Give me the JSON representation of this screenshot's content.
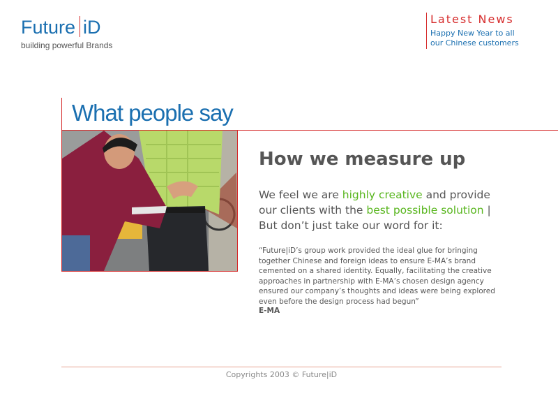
{
  "brand": {
    "name_left": "Future",
    "name_right": "iD",
    "tagline": "building powerful Brands"
  },
  "news": {
    "title": "Latest News",
    "item_line1": "Happy New Year to all",
    "item_line2": "our Chinese customers"
  },
  "section": {
    "title": "What people say"
  },
  "content": {
    "heading": "How we measure up",
    "lead_1": "We feel we are ",
    "lead_hl1": "highly creative",
    "lead_2": " and provide our clients with the ",
    "lead_hl2": "best possible",
    "lead_hl3": "solution",
    "lead_3": " | But don’t just take our word for it:",
    "quote": "“Future|iD’s group work provided the ideal glue for bringing together Chinese and foreign ideas to ensure E-MA’s brand cemented on a shared identity. Equally, facilitating the creative approaches in partnership with E-MA’s chosen design agency ensured our company’s thoughts and ideas were being explored even before the design process had begun”",
    "author": "E-MA"
  },
  "footer": {
    "copyright": "Copyrights 2003 © Future|iD"
  },
  "colors": {
    "brand_blue": "#1a6fb0",
    "accent_red": "#d62b2b",
    "highlight_green": "#59b61f",
    "text_gray": "#555555"
  }
}
